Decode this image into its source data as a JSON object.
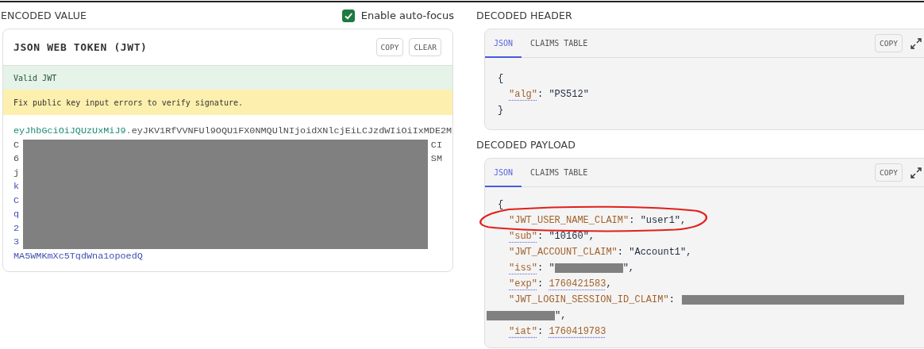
{
  "encoded": {
    "title": "ENCODED VALUE",
    "autofocus": {
      "label": "Enable auto-focus",
      "checked": true
    },
    "card": {
      "title": "JSON WEB TOKEN (JWT)",
      "buttons": [
        "COPY",
        "CLEAR"
      ],
      "messages": [
        {
          "kind": "success",
          "text": "Valid JWT"
        },
        {
          "kind": "warning",
          "text": "Fix public key input errors to verify signature."
        }
      ],
      "token": {
        "first_line": [
          {
            "kind": "header",
            "text": "eyJhbGciOiJQUzUxMiJ9."
          },
          {
            "kind": "payload",
            "text": "eyJKV1RfVVNFUl9OQU1FX0NMQUlNIjoidXNlcjEiLCJzdWIiOiIxMDE2M"
          }
        ],
        "covered_lines": [
          {
            "start": {
              "kind": "payload",
              "text": "C"
            },
            "end": {
              "kind": "payload",
              "text": "CI"
            }
          },
          {
            "start": {
              "kind": "payload",
              "text": "6"
            },
            "end": {
              "kind": "payload",
              "text": "SM"
            }
          },
          {
            "start": {
              "kind": "payload",
              "text": "j"
            }
          },
          {
            "start": {
              "kind": "signature",
              "text": "k"
            }
          },
          {
            "start": {
              "kind": "signature",
              "text": "C"
            }
          },
          {
            "start": {
              "kind": "signature",
              "text": "q"
            }
          },
          {
            "start": {
              "kind": "signature",
              "text": "2"
            }
          },
          {
            "start": {
              "kind": "signature",
              "text": "3"
            }
          }
        ],
        "last_line": [
          {
            "kind": "signature",
            "text": "MA5WMKmXc5TqdWna1opoedQ"
          }
        ],
        "redacted": true
      }
    }
  },
  "decoded_header": {
    "title": "DECODED HEADER",
    "tabs": [
      {
        "label": "JSON",
        "selected": true
      },
      {
        "label": "CLAIMS TABLE",
        "selected": false
      }
    ],
    "button": "COPY",
    "lines": [
      {
        "kind": "brace",
        "highlighted": false,
        "tokens": [
          {
            "kind": "punct",
            "text": "{"
          }
        ]
      },
      {
        "kind": "claim",
        "highlighted": false,
        "tokens": [
          {
            "kind": "key",
            "text": "\"alg\"",
            "underlined": true
          },
          {
            "kind": "punct",
            "text": ": "
          },
          {
            "kind": "string",
            "text": "\"PS512\""
          }
        ]
      },
      {
        "kind": "brace",
        "highlighted": false,
        "tokens": [
          {
            "kind": "punct",
            "text": "}"
          }
        ]
      }
    ]
  },
  "decoded_payload": {
    "title": "DECODED PAYLOAD",
    "tabs": [
      {
        "label": "JSON",
        "selected": true
      },
      {
        "label": "CLAIMS TABLE",
        "selected": false
      }
    ],
    "button": "COPY",
    "lines": [
      {
        "kind": "brace",
        "highlighted": false,
        "tokens": [
          {
            "kind": "punct",
            "text": "{"
          }
        ]
      },
      {
        "kind": "claim",
        "highlighted": true,
        "tokens": [
          {
            "kind": "key",
            "text": "\"JWT_USER_NAME_CLAIM\""
          },
          {
            "kind": "punct",
            "text": ": "
          },
          {
            "kind": "string",
            "text": "\"user1\""
          },
          {
            "kind": "punct",
            "text": ","
          }
        ]
      },
      {
        "kind": "claim",
        "highlighted": false,
        "tokens": [
          {
            "kind": "key",
            "text": "\"sub\"",
            "underlined": true
          },
          {
            "kind": "punct",
            "text": ": "
          },
          {
            "kind": "string",
            "text": "\"10160\""
          },
          {
            "kind": "punct",
            "text": ","
          }
        ]
      },
      {
        "kind": "claim",
        "highlighted": false,
        "tokens": [
          {
            "kind": "key",
            "text": "\"JWT_ACCOUNT_CLAIM\""
          },
          {
            "kind": "punct",
            "text": ": "
          },
          {
            "kind": "string",
            "text": "\"Account1\""
          },
          {
            "kind": "punct",
            "text": ","
          }
        ]
      },
      {
        "kind": "claim",
        "highlighted": false,
        "tokens": [
          {
            "kind": "key",
            "text": "\"iss\"",
            "underlined": true
          },
          {
            "kind": "punct",
            "text": ": \""
          },
          {
            "kind": "redacted"
          },
          {
            "kind": "punct",
            "text": "\","
          }
        ]
      },
      {
        "kind": "claim",
        "highlighted": false,
        "tokens": [
          {
            "kind": "key",
            "text": "\"exp\"",
            "underlined": true
          },
          {
            "kind": "punct",
            "text": ": "
          },
          {
            "kind": "number",
            "text": "1760421583",
            "underlined": true
          },
          {
            "kind": "punct",
            "text": ","
          }
        ]
      },
      {
        "kind": "claim",
        "highlighted": false,
        "tokens": [
          {
            "kind": "key",
            "text": "\"JWT_LOGIN_SESSION_ID_CLAIM\""
          },
          {
            "kind": "punct",
            "text": ": "
          },
          {
            "kind": "redacted"
          }
        ]
      },
      {
        "kind": "continuation",
        "highlighted": false,
        "tokens": [
          {
            "kind": "redacted"
          },
          {
            "kind": "punct",
            "text": "\","
          }
        ]
      },
      {
        "kind": "claim",
        "highlighted": false,
        "tokens": [
          {
            "kind": "key",
            "text": "\"iat\"",
            "underlined": true
          },
          {
            "kind": "punct",
            "text": ": "
          },
          {
            "kind": "number",
            "text": "1760419783",
            "underlined": true
          }
        ]
      }
    ]
  }
}
